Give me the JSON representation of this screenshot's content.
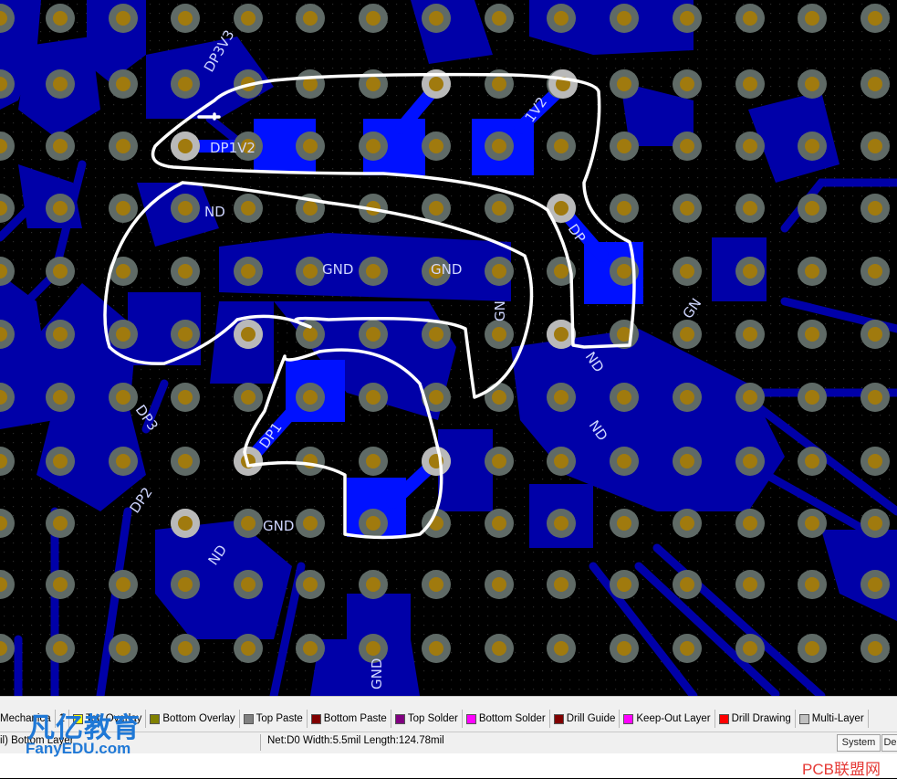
{
  "board": {
    "net_labels": [
      "DP3V3",
      "DP1V2",
      "1V2",
      "ND",
      "GND",
      "GND",
      "GN",
      "DP",
      "GN",
      "ND",
      "ND",
      "DP1",
      "DP3",
      "DP2",
      "GND",
      "ND",
      "GND"
    ],
    "colors": {
      "background": "#000000",
      "copper": "#0000a8",
      "pad": "#0011ff",
      "via_ring": "#b9b9b9",
      "via_hole": "#a07a0e",
      "annotation": "#ffffff"
    }
  },
  "layer_tabs": [
    {
      "label": "Mechanica",
      "color": "#ffffff"
    },
    {
      "label": "1",
      "color": "#808080"
    },
    {
      "label": "Top Overlay",
      "color": "#ffff00"
    },
    {
      "label": "Bottom Overlay",
      "color": "#808000"
    },
    {
      "label": "Top Paste",
      "color": "#808080"
    },
    {
      "label": "Bottom Paste",
      "color": "#800000"
    },
    {
      "label": "Top Solder",
      "color": "#800080"
    },
    {
      "label": "Bottom Solder",
      "color": "#ff00ff"
    },
    {
      "label": "Drill Guide",
      "color": "#800000"
    },
    {
      "label": "Keep-Out Layer",
      "color": "#ff00ff"
    },
    {
      "label": "Drill Drawing",
      "color": "#ff0000"
    },
    {
      "label": "Multi-Layer",
      "color": "#c0c0c0"
    }
  ],
  "status": {
    "layer": "il) Bottom Layer",
    "net_info": "Net:D0 Width:5.5mil Length:124.78mil",
    "system_btn": "System",
    "design_btn": "De"
  },
  "watermark": {
    "logo": "凡亿教育",
    "sub": "FanyEDU.com",
    "right": "PCB联盟网"
  }
}
